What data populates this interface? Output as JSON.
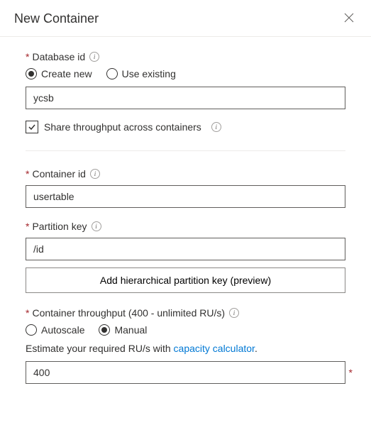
{
  "header": {
    "title": "New Container"
  },
  "database": {
    "label": "Database id",
    "radio_create": "Create new",
    "radio_existing": "Use existing",
    "selected": "create",
    "value": "ycsb",
    "share_throughput_label": "Share throughput across containers",
    "share_throughput_checked": true
  },
  "container": {
    "label": "Container id",
    "value": "usertable"
  },
  "partition": {
    "label": "Partition key",
    "value": "/id",
    "hierarchical_btn": "Add hierarchical partition key (preview)"
  },
  "throughput": {
    "label": "Container throughput (400 - unlimited RU/s)",
    "radio_autoscale": "Autoscale",
    "radio_manual": "Manual",
    "selected": "manual",
    "help_prefix": "Estimate your required RU/s with ",
    "help_link": "capacity calculator",
    "help_suffix": ".",
    "value": "400"
  }
}
